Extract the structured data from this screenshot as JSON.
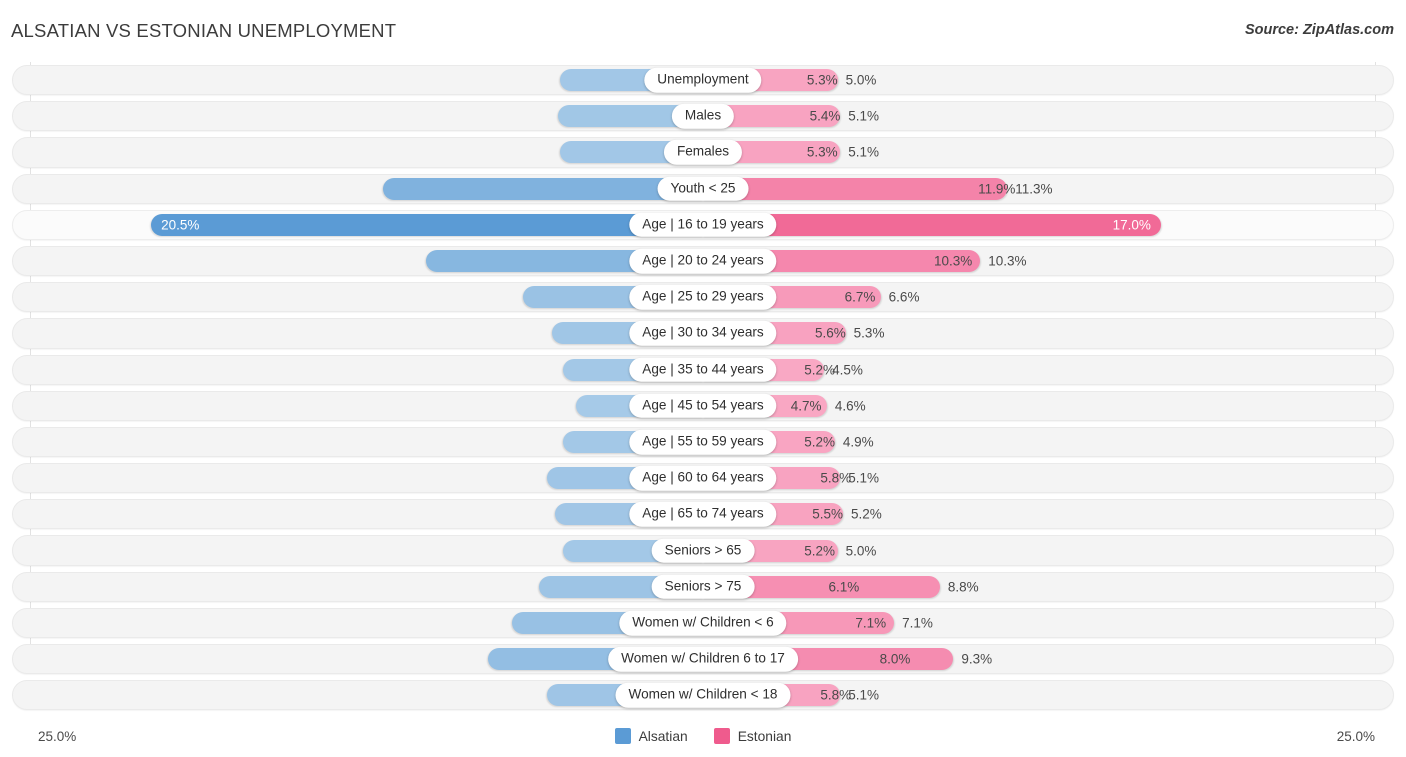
{
  "header": {
    "title": "ALSATIAN VS ESTONIAN UNEMPLOYMENT",
    "source": "Source: ZipAtlas.com"
  },
  "axis": {
    "left_label": "25.0%",
    "right_label": "25.0%",
    "max": 25.0
  },
  "legend": {
    "items": [
      {
        "label": "Alsatian",
        "color": "#5b9bd5"
      },
      {
        "label": "Estonian",
        "color": "#ef5b8d"
      }
    ]
  },
  "colors": {
    "left_light": "#a8cbe8",
    "left_mid": "#8cb9e2",
    "left_strong": "#5b9bd5",
    "right_light": "#f9a8c4",
    "right_mid": "#f58bae",
    "right_strong": "#ef5b8d",
    "track": "#f4f4f4",
    "gridline": "#e2e2e2"
  },
  "chart_data": {
    "type": "bar",
    "orientation": "horizontal-diverging",
    "title": "ALSATIAN VS ESTONIAN UNEMPLOYMENT",
    "xlabel": "",
    "ylabel": "",
    "xlim": [
      25.0,
      25.0
    ],
    "grid": true,
    "legend_position": "bottom-center",
    "series": [
      {
        "name": "Alsatian",
        "side": "left",
        "color": "#5b9bd5",
        "values": [
          5.3,
          5.4,
          5.3,
          11.9,
          20.5,
          10.3,
          6.7,
          5.6,
          5.2,
          4.7,
          5.2,
          5.8,
          5.5,
          5.2,
          6.1,
          7.1,
          8.0,
          5.8
        ]
      },
      {
        "name": "Estonian",
        "side": "right",
        "color": "#ef5b8d",
        "values": [
          5.0,
          5.1,
          5.1,
          11.3,
          17.0,
          10.3,
          6.6,
          5.3,
          4.5,
          4.6,
          4.9,
          5.1,
          5.2,
          5.0,
          8.8,
          7.1,
          9.3,
          5.1
        ]
      }
    ],
    "categories": [
      "Unemployment",
      "Males",
      "Females",
      "Youth < 25",
      "Age | 16 to 19 years",
      "Age | 20 to 24 years",
      "Age | 25 to 29 years",
      "Age | 30 to 34 years",
      "Age | 35 to 44 years",
      "Age | 45 to 54 years",
      "Age | 55 to 59 years",
      "Age | 60 to 64 years",
      "Age | 65 to 74 years",
      "Seniors > 65",
      "Seniors > 75",
      "Women w/ Children < 6",
      "Women w/ Children 6 to 17",
      "Women w/ Children < 18"
    ]
  },
  "rows": [
    {
      "category": "Unemployment",
      "left_value": 5.3,
      "right_value": 5.0,
      "left_text": "5.3%",
      "right_text": "5.0%",
      "highlight": false
    },
    {
      "category": "Males",
      "left_value": 5.4,
      "right_value": 5.1,
      "left_text": "5.4%",
      "right_text": "5.1%",
      "highlight": false
    },
    {
      "category": "Females",
      "left_value": 5.3,
      "right_value": 5.1,
      "left_text": "5.3%",
      "right_text": "5.1%",
      "highlight": false
    },
    {
      "category": "Youth < 25",
      "left_value": 11.9,
      "right_value": 11.3,
      "left_text": "11.9%",
      "right_text": "11.3%",
      "highlight": false
    },
    {
      "category": "Age | 16 to 19 years",
      "left_value": 20.5,
      "right_value": 17.0,
      "left_text": "20.5%",
      "right_text": "17.0%",
      "highlight": true
    },
    {
      "category": "Age | 20 to 24 years",
      "left_value": 10.3,
      "right_value": 10.3,
      "left_text": "10.3%",
      "right_text": "10.3%",
      "highlight": false
    },
    {
      "category": "Age | 25 to 29 years",
      "left_value": 6.7,
      "right_value": 6.6,
      "left_text": "6.7%",
      "right_text": "6.6%",
      "highlight": false
    },
    {
      "category": "Age | 30 to 34 years",
      "left_value": 5.6,
      "right_value": 5.3,
      "left_text": "5.6%",
      "right_text": "5.3%",
      "highlight": false
    },
    {
      "category": "Age | 35 to 44 years",
      "left_value": 5.2,
      "right_value": 4.5,
      "left_text": "5.2%",
      "right_text": "4.5%",
      "highlight": false
    },
    {
      "category": "Age | 45 to 54 years",
      "left_value": 4.7,
      "right_value": 4.6,
      "left_text": "4.7%",
      "right_text": "4.6%",
      "highlight": false
    },
    {
      "category": "Age | 55 to 59 years",
      "left_value": 5.2,
      "right_value": 4.9,
      "left_text": "5.2%",
      "right_text": "4.9%",
      "highlight": false
    },
    {
      "category": "Age | 60 to 64 years",
      "left_value": 5.8,
      "right_value": 5.1,
      "left_text": "5.8%",
      "right_text": "5.1%",
      "highlight": false
    },
    {
      "category": "Age | 65 to 74 years",
      "left_value": 5.5,
      "right_value": 5.2,
      "left_text": "5.5%",
      "right_text": "5.2%",
      "highlight": false
    },
    {
      "category": "Seniors > 65",
      "left_value": 5.2,
      "right_value": 5.0,
      "left_text": "5.2%",
      "right_text": "5.0%",
      "highlight": false
    },
    {
      "category": "Seniors > 75",
      "left_value": 6.1,
      "right_value": 8.8,
      "left_text": "6.1%",
      "right_text": "8.8%",
      "highlight": false
    },
    {
      "category": "Women w/ Children < 6",
      "left_value": 7.1,
      "right_value": 7.1,
      "left_text": "7.1%",
      "right_text": "7.1%",
      "highlight": false
    },
    {
      "category": "Women w/ Children 6 to 17",
      "left_value": 8.0,
      "right_value": 9.3,
      "left_text": "8.0%",
      "right_text": "9.3%",
      "highlight": false
    },
    {
      "category": "Women w/ Children < 18",
      "left_value": 5.8,
      "right_value": 5.1,
      "left_text": "5.8%",
      "right_text": "5.1%",
      "highlight": false
    }
  ]
}
